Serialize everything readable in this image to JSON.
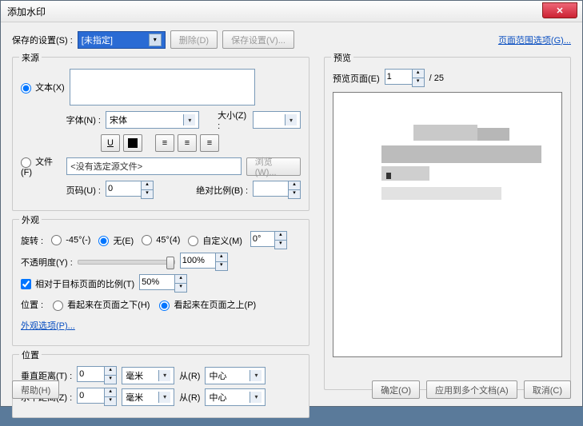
{
  "window": {
    "title": "添加水印"
  },
  "toolbar": {
    "saved_label": "保存的设置(S) :",
    "saved_value": "[未指定]",
    "delete_btn": "删除(D)",
    "save_btn": "保存设置(V)...",
    "page_range_link": "页面范围选项(G)..."
  },
  "source": {
    "legend": "来源",
    "text_radio": "文本(X)",
    "font_label": "字体(N) :",
    "font_value": "宋体",
    "size_label": "大小(Z) :",
    "size_value": "",
    "file_radio": "文件(F)",
    "file_value": "<没有选定源文件>",
    "browse_btn": "浏览(W)...",
    "page_label": "页码(U) :",
    "page_value": "0",
    "scale_label": "绝对比例(B) :",
    "scale_value": ""
  },
  "appearance": {
    "legend": "外观",
    "rotate_label": "旋转 :",
    "rot_n45": "-45°(-)",
    "rot_0": "无(E)",
    "rot_45": "45°(4)",
    "rot_custom": "自定义(M)",
    "rot_value": "0°",
    "opacity_label": "不透明度(Y) :",
    "opacity_value": "100%",
    "relscale_chk": "相对于目标页面的比例(T)",
    "relscale_value": "50%",
    "pos_label": "位置 :",
    "pos_below": "看起来在页面之下(H)",
    "pos_above": "看起来在页面之上(P)",
    "appearance_link": "外观选项(P)..."
  },
  "position": {
    "legend": "位置",
    "vdist_label": "垂直距离(T) :",
    "vdist_value": "0",
    "unit_value": "毫米",
    "from_label": "从(R)",
    "from_value": "中心",
    "hdist_label": "水平距离(Z) :",
    "hdist_value": "0"
  },
  "preview": {
    "legend": "预览",
    "page_label": "预览页面(E)",
    "page_value": "1",
    "page_total": "/ 25"
  },
  "footer": {
    "help": "帮助(H)",
    "ok": "确定(O)",
    "apply_multi": "应用到多个文档(A)",
    "cancel": "取消(C)"
  }
}
